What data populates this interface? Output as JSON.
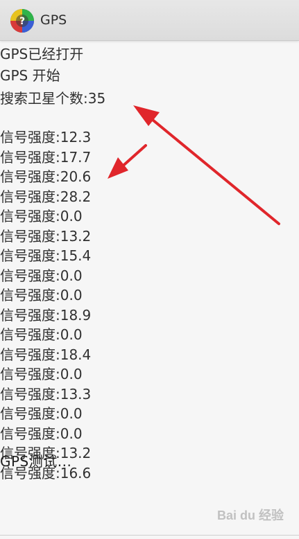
{
  "app": {
    "title": "GPS",
    "icon": "gps-app-icon"
  },
  "log": [
    "GPS已经打开",
    "GPS 开始",
    "搜索卫星个数:35",
    "",
    "信号强度:12.3",
    "信号强度:17.7",
    "信号强度:20.6",
    "信号强度:28.2",
    "信号强度:0.0",
    "信号强度:13.2",
    "信号强度:15.4",
    "信号强度:0.0",
    "信号强度:0.0",
    "信号强度:18.9",
    "信号强度:0.0",
    "信号强度:18.4",
    "信号强度:0.0",
    "信号强度:13.3",
    "信号强度:0.0",
    "信号强度:0.0",
    "信号强度:13.2",
    "信号强度:16.6"
  ],
  "overlay_text": "GPS测试...",
  "annotation_color": "#e0262b",
  "watermark": "Bai du 经验"
}
